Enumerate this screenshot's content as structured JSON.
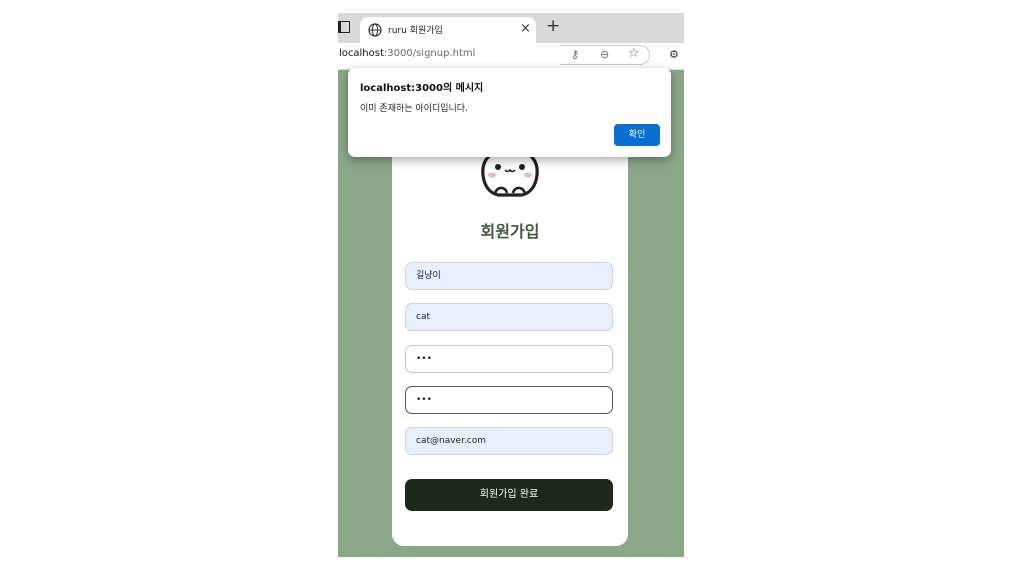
{
  "browser": {
    "tab_title": "ruru 회원가입",
    "url_host": "localhost",
    "url_rest": ":3000/signup.html"
  },
  "page": {
    "heading": "회원가입",
    "fields": [
      {
        "value": "길냥이",
        "state": "autofilled"
      },
      {
        "value": "cat",
        "state": "autofilled"
      },
      {
        "value": "•••",
        "state": "password"
      },
      {
        "value": "•••",
        "state": "password-focused"
      },
      {
        "value": "cat@naver.com",
        "state": "autofilled"
      }
    ],
    "submit_label": "회원가입 완료"
  },
  "dialog": {
    "title": "localhost:3000의 메시지",
    "message": "이미 존재하는 아이디입니다.",
    "ok_label": "확인"
  },
  "colors": {
    "page_bg": "#8aa888",
    "accent_button": "#0a6fd0",
    "submit_bg": "#1c2a1c",
    "heading": "#3e5a3b",
    "autofill_bg": "#e8effc"
  },
  "icons": [
    "tab-actions-icon",
    "globe-icon",
    "close-icon",
    "new-tab-icon",
    "key-icon",
    "zoom-icon",
    "favorite-star-icon",
    "extensions-icon",
    "cat-mascot-icon"
  ]
}
